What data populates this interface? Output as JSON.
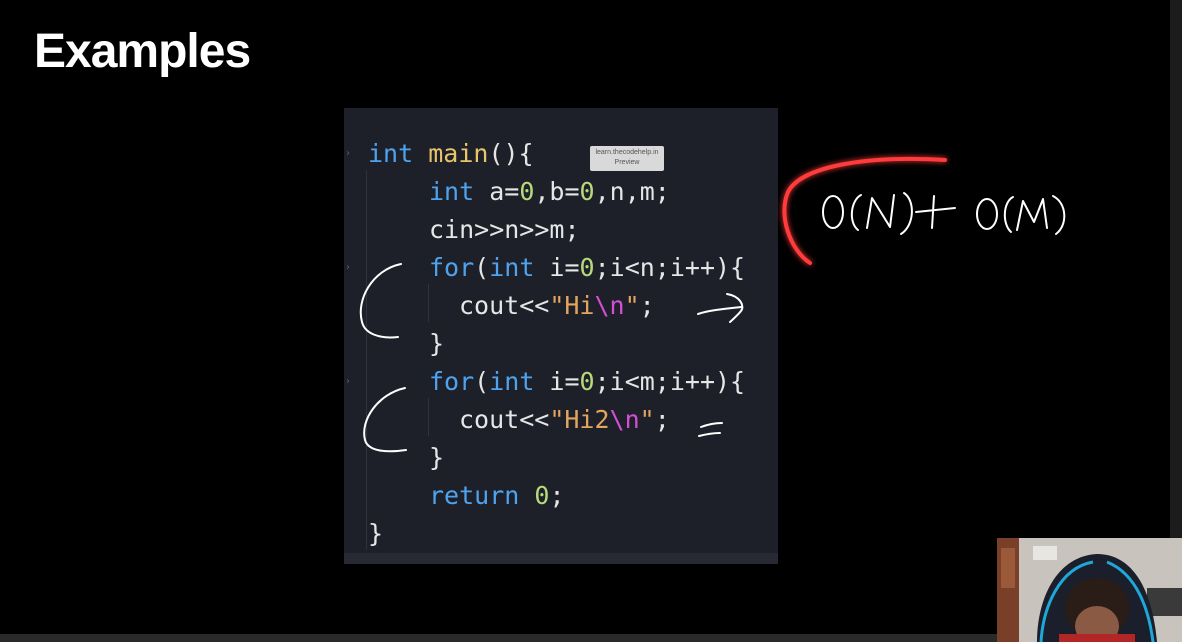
{
  "slide": {
    "title": "Examples"
  },
  "watermark": {
    "line1": "learn.thecodehelp.in",
    "line2": "Preview"
  },
  "code": {
    "line1": {
      "kw": "int",
      "fn": "main",
      "rest": "(){"
    },
    "line2": {
      "kw": "int",
      "p1": " a=",
      "n1": "0",
      "p2": ",b=",
      "n2": "0",
      "p3": ",n,m;"
    },
    "line3": {
      "text": "cin>>n>>m;"
    },
    "line4": {
      "kw1": "for",
      "p1": "(",
      "kw2": "int",
      "p2": " i=",
      "n1": "0",
      "p3": ";i<n;i++){"
    },
    "line5": {
      "p1": "cout<<",
      "s1": "\"Hi",
      "e1": "\\n",
      "s2": "\"",
      "p2": ";"
    },
    "line6": {
      "text": "}"
    },
    "line7": {
      "kw1": "for",
      "p1": "(",
      "kw2": "int",
      "p2": " i=",
      "n1": "0",
      "p3": ";i<m;i++){"
    },
    "line8": {
      "p1": "cout<<",
      "s1": "\"Hi2",
      "e1": "\\n",
      "s2": "\"",
      "p2": ";"
    },
    "line9": {
      "text": "}"
    },
    "line10": {
      "kw": "return",
      "sp": " ",
      "n1": "0",
      "p1": ";"
    },
    "line11": {
      "text": "}"
    }
  },
  "annotation": {
    "complexity_text": "O(N)+O(M)",
    "highlight_color": "#ff3b3b"
  },
  "icons": {
    "webcam": "presenter-webcam"
  }
}
